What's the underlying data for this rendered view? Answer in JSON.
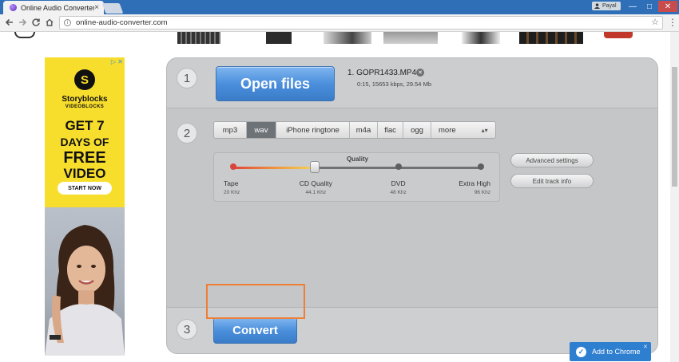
{
  "browser": {
    "tab_title": "Online Audio Converter",
    "tab_close": "×",
    "profile_name": "Payal",
    "url": "online-audio-converter.com",
    "window_controls": [
      "—",
      "□",
      "✕"
    ],
    "icons": [
      "back-arrow-icon",
      "forward-arrow-icon",
      "reload-icon",
      "home-icon",
      "info-icon",
      "star-icon",
      "menu-dots-icon"
    ]
  },
  "ad": {
    "close_marker": "▷ ✕",
    "logo_letter": "S",
    "brand": "Storyblocks",
    "brand_sub": "VIDEOBLOCKS",
    "headline": [
      "GET 7",
      "DAYS OF",
      "FREE",
      "VIDEO"
    ],
    "cta": "START NOW"
  },
  "step1": {
    "number": "1",
    "button_label": "Open files",
    "file_name": "1. GOPR1433.MP4",
    "file_remove": "✕",
    "file_meta": "0:15, 15653 kbps, 29.54 Mb"
  },
  "step2": {
    "number": "2",
    "formats": [
      "mp3",
      "wav",
      "iPhone ringtone",
      "m4a",
      "flac",
      "ogg",
      "more"
    ],
    "selected_format": "wav",
    "more_arrows": "▴▾",
    "quality": {
      "title": "Quality",
      "selected_index": 1,
      "level": 0.33,
      "stops": [
        {
          "label": "Tape",
          "sub": "20 Khz"
        },
        {
          "label": "CD Quality",
          "sub": "44.1 Khz"
        },
        {
          "label": "DVD",
          "sub": "48 Khz"
        },
        {
          "label": "Extra High",
          "sub": "96 Khz"
        }
      ]
    },
    "advanced_settings": "Advanced settings",
    "edit_track_info": "Edit track info"
  },
  "step3": {
    "number": "3",
    "button_label": "Convert"
  },
  "add_to_chrome": {
    "label": "Add to Chrome",
    "close": "✕"
  },
  "colors": {
    "titlebar": "#2f6fb8",
    "panel": "#c4c6c8",
    "button_blue": "#4b8fdc",
    "ad_yellow": "#f8de2c",
    "highlight_orange": "#f07e34",
    "add_chrome_blue": "#2f7fd1"
  }
}
